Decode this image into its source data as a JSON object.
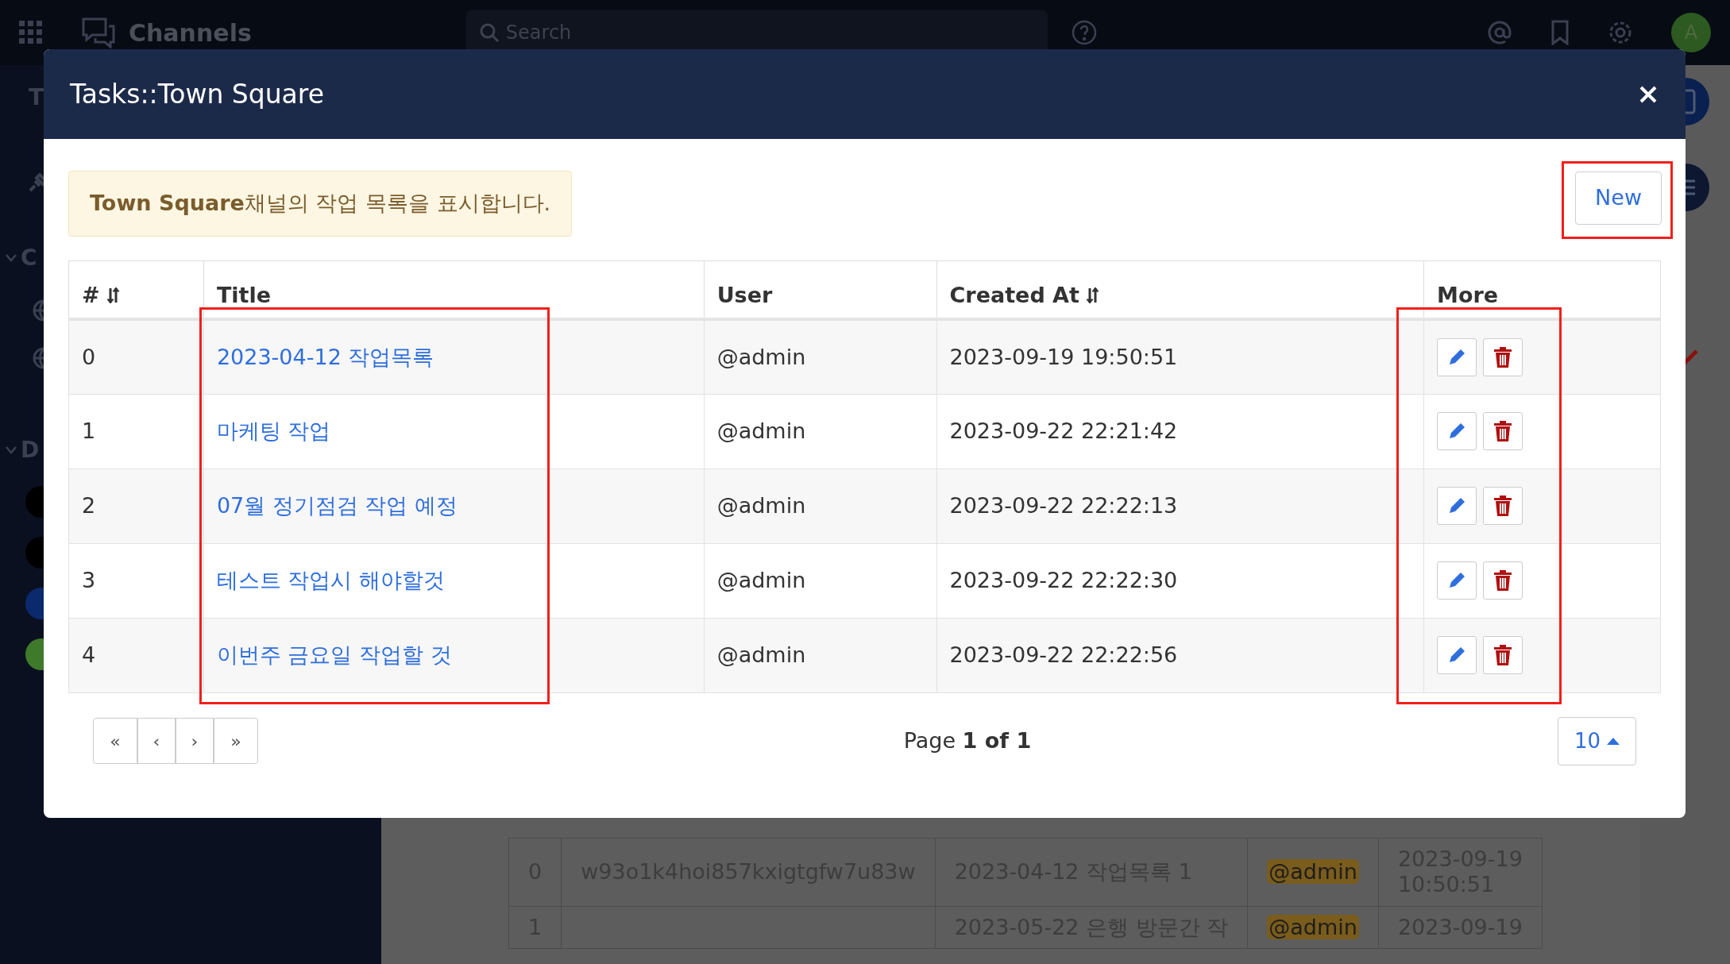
{
  "app": {
    "title": "Channels",
    "search": {
      "placeholder": "Search"
    },
    "avatar": "A",
    "sidebar": {
      "heading": "T",
      "sections": [
        {
          "label": "C"
        },
        {
          "label": "D"
        }
      ],
      "avatars": [
        {
          "color": "#000000"
        },
        {
          "color": "#000000"
        },
        {
          "color": "#0b2a6e"
        },
        {
          "color": "#3f7a2a"
        }
      ]
    },
    "background_table": {
      "rows": [
        {
          "num": "0",
          "task_id": "w93o1k4hoi857kxigtgfw7u83w",
          "task_title": "2023-04-12 작업목록 1",
          "user": "@admin",
          "create_at": [
            "2023-09-19",
            "10:50:51"
          ]
        },
        {
          "num": "1",
          "task_id": "",
          "task_title": "2023-05-22 은행 방문간 작",
          "user": "@admin",
          "create_at": [
            "2023-09-19"
          ]
        }
      ]
    }
  },
  "modal": {
    "title": "Tasks::Town Square",
    "notice": "**Town Square**채널의 작업 목록을 표시합니다.",
    "new_button": "New",
    "table": {
      "columns": [
        {
          "label": "#",
          "sortable": true
        },
        {
          "label": "Title",
          "sortable": false
        },
        {
          "label": "User",
          "sortable": false
        },
        {
          "label": "Created At",
          "sortable": true
        },
        {
          "label": "More",
          "sortable": false
        }
      ],
      "rows": [
        {
          "num": "0",
          "title": "2023-04-12 작업목록",
          "user": "@admin",
          "created_at": "2023-09-19 19:50:51"
        },
        {
          "num": "1",
          "title": "마케팅 작업",
          "user": "@admin",
          "created_at": "2023-09-22 22:21:42"
        },
        {
          "num": "2",
          "title": "07월 정기점검 작업 예정",
          "user": "@admin",
          "created_at": "2023-09-22 22:22:13"
        },
        {
          "num": "3",
          "title": "테스트 작업시 해야할것",
          "user": "@admin",
          "created_at": "2023-09-22 22:22:30"
        },
        {
          "num": "4",
          "title": "이번주 금요일 작업할 것",
          "user": "@admin",
          "created_at": "2023-09-22 22:22:56"
        }
      ]
    },
    "pagination": {
      "buttons": [
        "«",
        "‹",
        "›",
        "»"
      ],
      "page_label": "Page **1 of 1**",
      "page_size": "10"
    }
  }
}
